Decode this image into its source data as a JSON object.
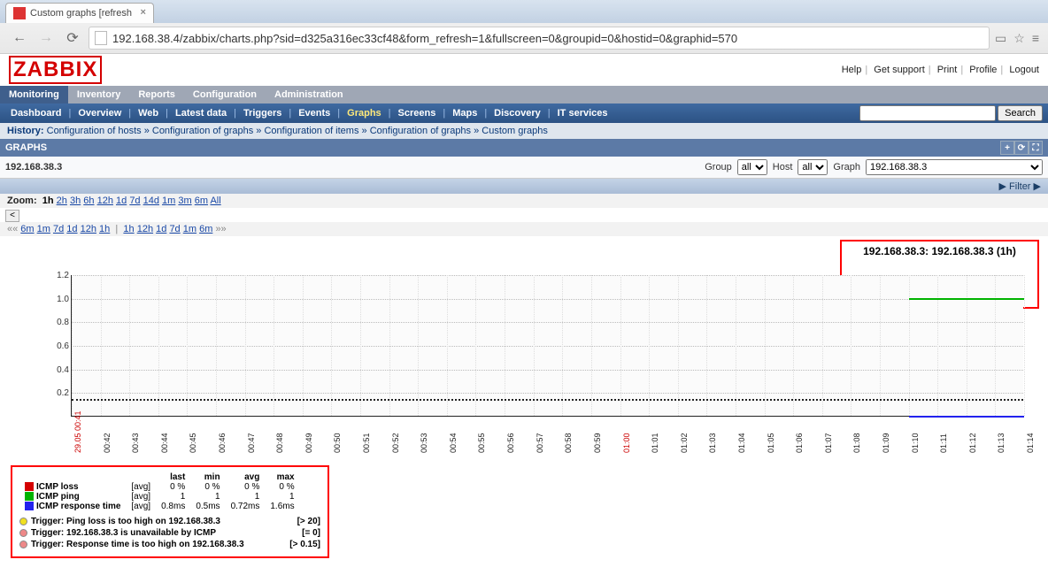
{
  "browser": {
    "tab_title": "Custom graphs [refresh",
    "url": "192.168.38.4/zabbix/charts.php?sid=d325a316ec33cf48&form_refresh=1&fullscreen=0&groupid=0&hostid=0&graphid=570"
  },
  "header": {
    "logo": "ZABBIX",
    "links": [
      "Help",
      "Get support",
      "Print",
      "Profile",
      "Logout"
    ]
  },
  "main_menu": [
    "Monitoring",
    "Inventory",
    "Reports",
    "Configuration",
    "Administration"
  ],
  "main_menu_active": "Monitoring",
  "sub_menu": [
    "Dashboard",
    "Overview",
    "Web",
    "Latest data",
    "Triggers",
    "Events",
    "Graphs",
    "Screens",
    "Maps",
    "Discovery",
    "IT services"
  ],
  "sub_menu_active": "Graphs",
  "search_label": "Search",
  "history": {
    "label": "History:",
    "crumbs": [
      "Configuration of hosts",
      "Configuration of graphs",
      "Configuration of items",
      "Configuration of graphs",
      "Custom graphs"
    ]
  },
  "graphs_bar_label": "GRAPHS",
  "host_title": "192.168.38.3",
  "filters": {
    "group_label": "Group",
    "group_value": "all",
    "host_label": "Host",
    "host_value": "all",
    "graph_label": "Graph",
    "graph_value": "192.168.38.3"
  },
  "filter_link": "▶ Filter ▶",
  "zoom": {
    "label": "Zoom:",
    "active": "1h",
    "options": [
      "2h",
      "3h",
      "6h",
      "12h",
      "1d",
      "7d",
      "14d",
      "1m",
      "3m",
      "6m",
      "All"
    ]
  },
  "time_nav": {
    "back": [
      "6m",
      "1m",
      "7d",
      "1d",
      "12h",
      "1h"
    ],
    "fwd": [
      "1h",
      "12h",
      "1d",
      "7d",
      "1m",
      "6m"
    ]
  },
  "chart_data": {
    "type": "line",
    "title": "192.168.38.3: 192.168.38.3 (1h)",
    "ylim": [
      0,
      1.2
    ],
    "yticks": [
      0.2,
      0.4,
      0.6,
      0.8,
      1.0,
      1.2
    ],
    "x": [
      "29.05 00:41",
      "00:42",
      "00:43",
      "00:44",
      "00:45",
      "00:46",
      "00:47",
      "00:48",
      "00:49",
      "00:50",
      "00:51",
      "00:52",
      "00:53",
      "00:54",
      "00:55",
      "00:56",
      "00:57",
      "00:58",
      "00:59",
      "01:00",
      "01:01",
      "01:02",
      "01:03",
      "01:04",
      "01:05",
      "01:06",
      "01:07",
      "01:08",
      "01:09",
      "01:10",
      "01:11",
      "01:12",
      "01:13",
      "01:14"
    ],
    "threshold": 0.15,
    "series": [
      {
        "name": "ICMP ping",
        "color": "#00b300",
        "from_index": 29,
        "value": 1.0
      },
      {
        "name": "ICMP response time",
        "color": "#2222ee",
        "from_index": 29,
        "value": 0.0
      }
    ]
  },
  "legend": {
    "headers": [
      "last",
      "min",
      "avg",
      "max"
    ],
    "rows": [
      {
        "color": "#d40000",
        "name": "ICMP loss",
        "agg": "[avg]",
        "last": "0 %",
        "min": "0 %",
        "avg": "0 %",
        "max": "0 %"
      },
      {
        "color": "#00b300",
        "name": "ICMP ping",
        "agg": "[avg]",
        "last": "1",
        "min": "1",
        "avg": "1",
        "max": "1"
      },
      {
        "color": "#2222ee",
        "name": "ICMP response time",
        "agg": "[avg]",
        "last": "0.8ms",
        "min": "0.5ms",
        "avg": "0.72ms",
        "max": "1.6ms"
      }
    ],
    "triggers": [
      {
        "color": "#f0e020",
        "label": "Trigger: Ping loss is too high on 192.168.38.3",
        "cond": "[> 20]"
      },
      {
        "color": "#e88",
        "label": "Trigger: 192.168.38.3 is unavailable by ICMP",
        "cond": "[= 0]"
      },
      {
        "color": "#e88",
        "label": "Trigger: Response time is too high on 192.168.38.3",
        "cond": "[> 0.15]"
      }
    ]
  }
}
